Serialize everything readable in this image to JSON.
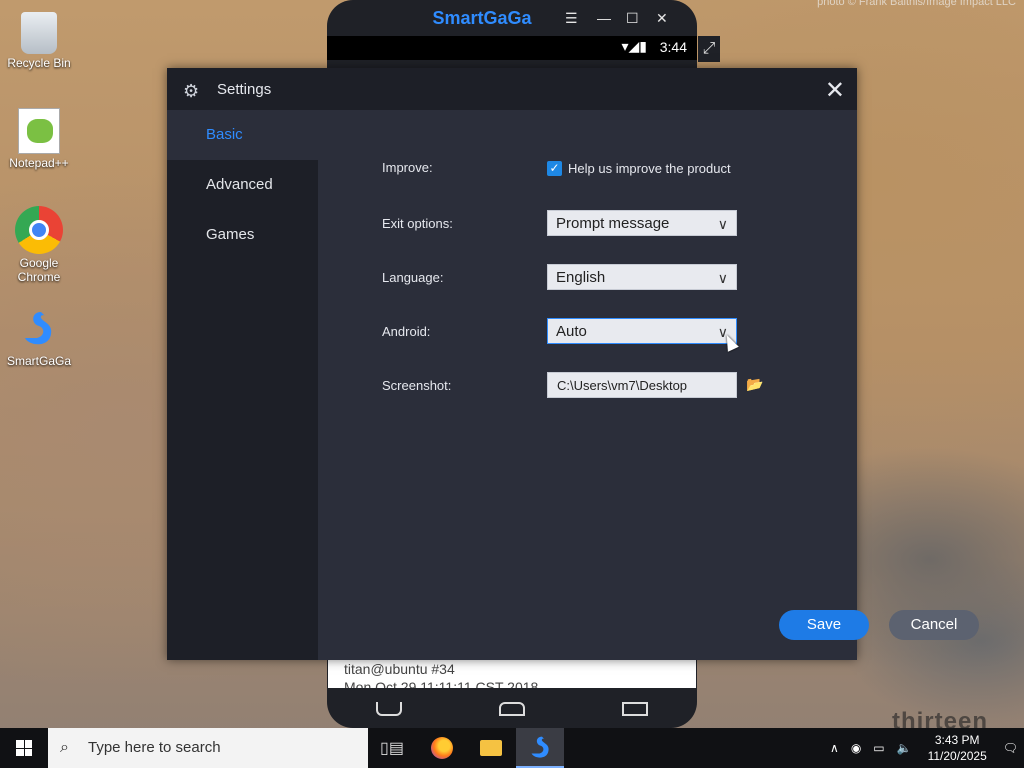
{
  "desktop": {
    "watermark": "photo © Frank Baithis/Image Impact LLC",
    "icons": [
      {
        "label": "Recycle Bin"
      },
      {
        "label": "Notepad++"
      },
      {
        "label": "Google Chrome"
      },
      {
        "label": "SmartGaGa"
      }
    ]
  },
  "emulator": {
    "title": "SmartGaGa",
    "status_time": "3:44",
    "terminal": [
      "titan@ubuntu #34",
      "Mon Oct 29 11:11:11 CST 2018"
    ]
  },
  "settings": {
    "title": "Settings",
    "sidebar": [
      {
        "label": "Basic",
        "active": true
      },
      {
        "label": "Advanced",
        "active": false
      },
      {
        "label": "Games",
        "active": false
      }
    ],
    "rows": {
      "improve": {
        "label": "Improve:",
        "checkbox_label": "Help us improve the product",
        "checked": true
      },
      "exit": {
        "label": "Exit options:",
        "value": "Prompt message"
      },
      "language": {
        "label": "Language:",
        "value": "English"
      },
      "android": {
        "label": "Android:",
        "value": "Auto"
      },
      "screenshot": {
        "label": "Screenshot:",
        "value": "C:\\Users\\vm7\\Desktop"
      }
    },
    "buttons": {
      "save": "Save",
      "cancel": "Cancel"
    }
  },
  "taskbar": {
    "search_placeholder": "Type here to search",
    "time": "3:43 PM",
    "date": "11/20/2025"
  },
  "brand": "thirteen",
  "colors": {
    "accent": "#2f8cff",
    "dialog_bg": "#2b2e3a",
    "sidebar_bg": "#1d1f27"
  }
}
